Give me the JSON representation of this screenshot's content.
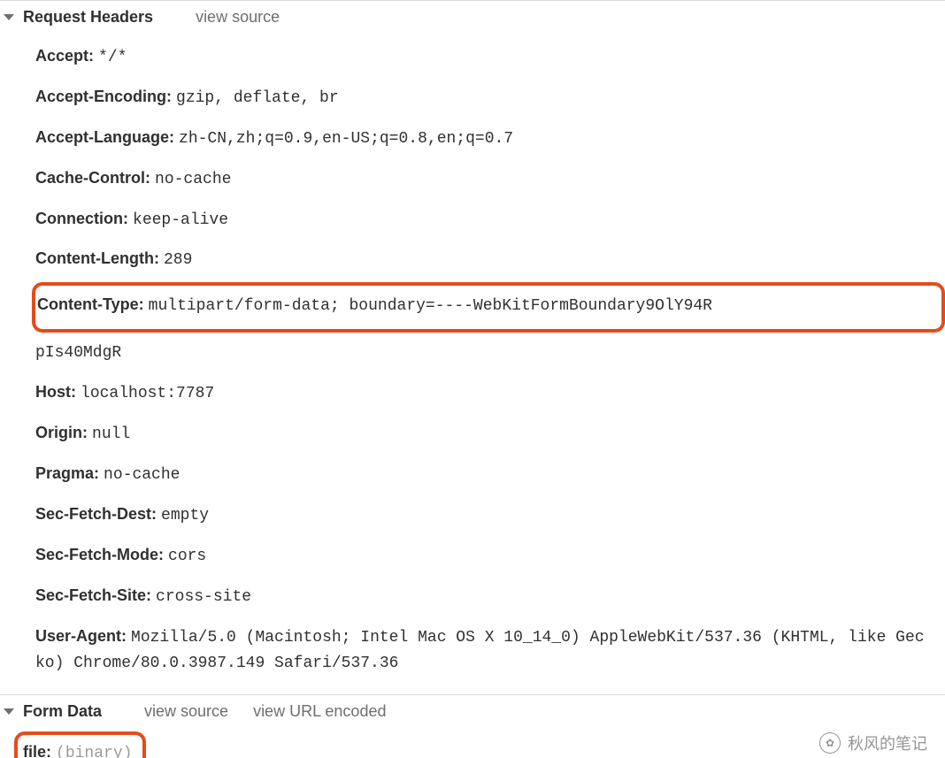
{
  "request_headers": {
    "title": "Request Headers",
    "view_source": "view source",
    "items": [
      {
        "name": "Accept:",
        "value": "*/*"
      },
      {
        "name": "Accept-Encoding:",
        "value": "gzip, deflate, br"
      },
      {
        "name": "Accept-Language:",
        "value": "zh-CN,zh;q=0.9,en-US;q=0.8,en;q=0.7"
      },
      {
        "name": "Cache-Control:",
        "value": "no-cache"
      },
      {
        "name": "Connection:",
        "value": "keep-alive"
      },
      {
        "name": "Content-Length:",
        "value": "289"
      },
      {
        "name": "Content-Type:",
        "value": "multipart/form-data; boundary=----WebKitFormBoundary9OlY94R",
        "continuation": "pIs40MdgR",
        "highlight": true
      },
      {
        "name": "Host:",
        "value": "localhost:7787"
      },
      {
        "name": "Origin:",
        "value": "null"
      },
      {
        "name": "Pragma:",
        "value": "no-cache"
      },
      {
        "name": "Sec-Fetch-Dest:",
        "value": "empty"
      },
      {
        "name": "Sec-Fetch-Mode:",
        "value": "cors"
      },
      {
        "name": "Sec-Fetch-Site:",
        "value": "cross-site"
      },
      {
        "name": "User-Agent:",
        "value": "Mozilla/5.0 (Macintosh; Intel Mac OS X 10_14_0) AppleWebKit/537.36 (KHTML, like Gecko) Chrome/80.0.3987.149 Safari/537.36"
      }
    ]
  },
  "form_data": {
    "title": "Form Data",
    "view_source": "view source",
    "view_url_encoded": "view URL encoded",
    "items": [
      {
        "name": "file:",
        "value": "(binary)"
      }
    ]
  },
  "watermark": {
    "text": "秋风的笔记"
  }
}
